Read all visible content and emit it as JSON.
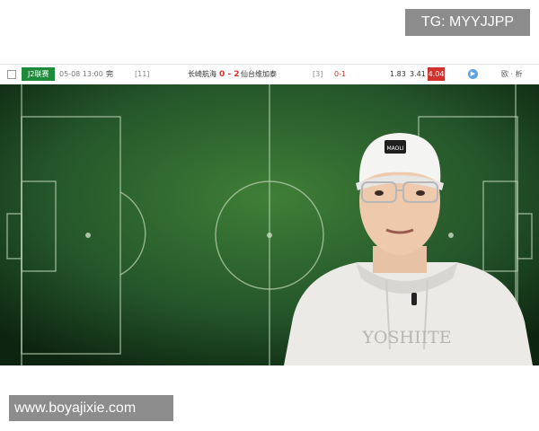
{
  "watermark_top": "TG: MYYJJPP",
  "match": {
    "league": "J2联赛",
    "time": "05-08 13:00",
    "status": "完",
    "home_rank": "[11]",
    "home_team": "长崎航海",
    "score": "0 - 2",
    "away_team": "仙台维加泰",
    "away_rank": "[3]",
    "halftime": "0-1",
    "odds": [
      "1.83",
      "3.41",
      "4.04"
    ],
    "links": "欧 · 析"
  },
  "video": {
    "cap_logo": "MAOLI",
    "hoodie_text": "YOSHIITE"
  },
  "watermark_bottom": "www.boyajixie.com"
}
